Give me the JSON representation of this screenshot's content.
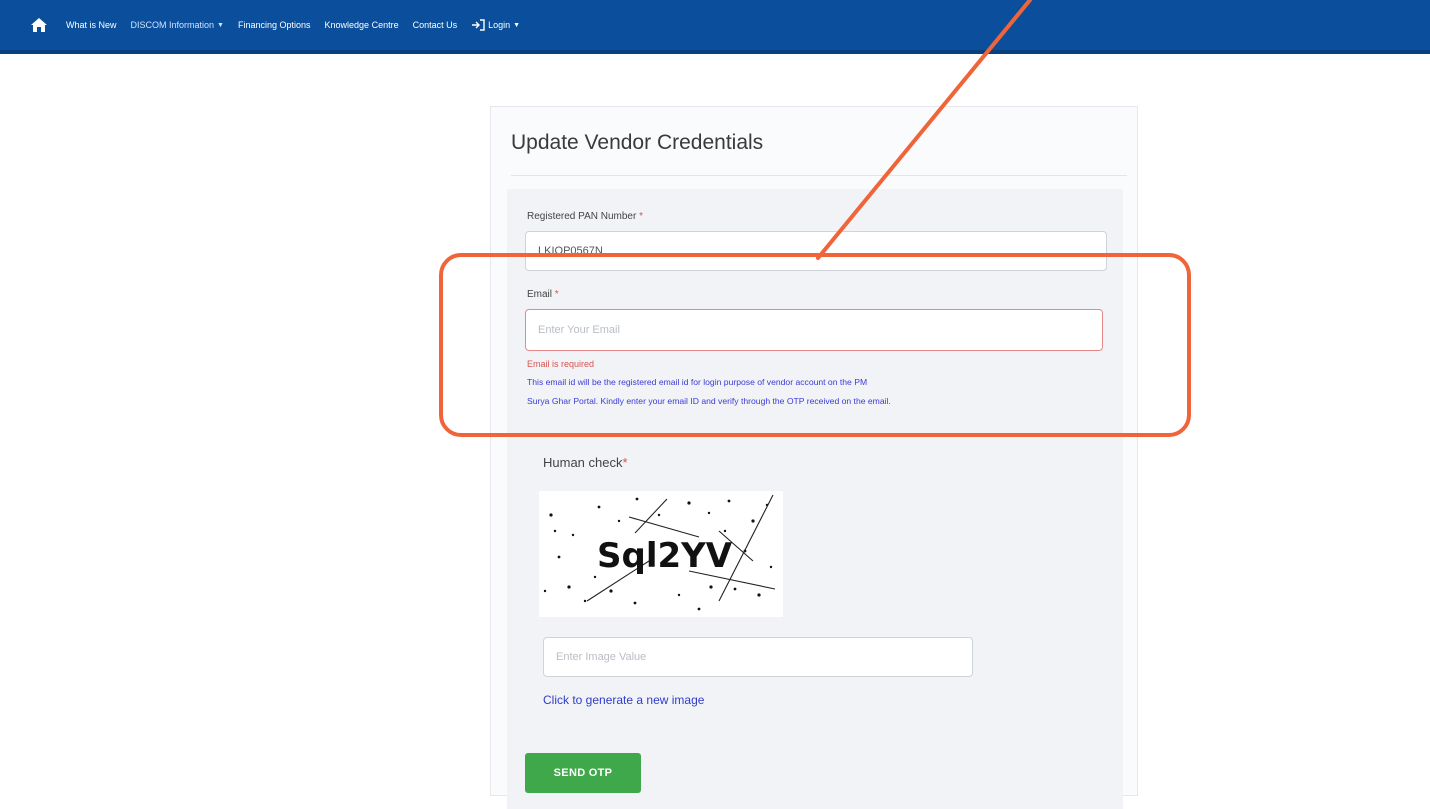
{
  "nav": {
    "items": [
      {
        "label": "What is New",
        "dropdown": false
      },
      {
        "label": "DISCOM Information",
        "dropdown": true
      },
      {
        "label": "Financing Options",
        "dropdown": false
      },
      {
        "label": "Knowledge Centre",
        "dropdown": false
      },
      {
        "label": "Contact Us",
        "dropdown": false
      }
    ],
    "login_label": "Login"
  },
  "card": {
    "title": "Update Vendor Credentials"
  },
  "form": {
    "pan": {
      "label": "Registered PAN Number",
      "required_mark": "*",
      "value": "LKIOP0567N"
    },
    "email": {
      "label": "Email",
      "required_mark": "*",
      "placeholder": "Enter Your Email",
      "value": "",
      "error": "Email is required",
      "help_line1": "This email id will be the registered email id for login purpose of vendor account on the PM",
      "help_line2": "Surya Ghar Portal. Kindly enter your email ID and verify through the OTP received on the email."
    },
    "human_check": {
      "label": "Human check",
      "required_mark": "*",
      "captcha_text": "Sql2YV",
      "input_placeholder": "Enter Image Value",
      "regen_link": "Click to generate a new image"
    },
    "send_button": "SEND OTP"
  },
  "colors": {
    "navbar": "#0b4f9c",
    "send_button": "#3fa84a",
    "annotation": "#f0643a",
    "error": "#d9534f",
    "help_text": "#3b3bd6"
  },
  "icons": [
    "home-icon",
    "login-icon",
    "chevron-down-icon"
  ]
}
